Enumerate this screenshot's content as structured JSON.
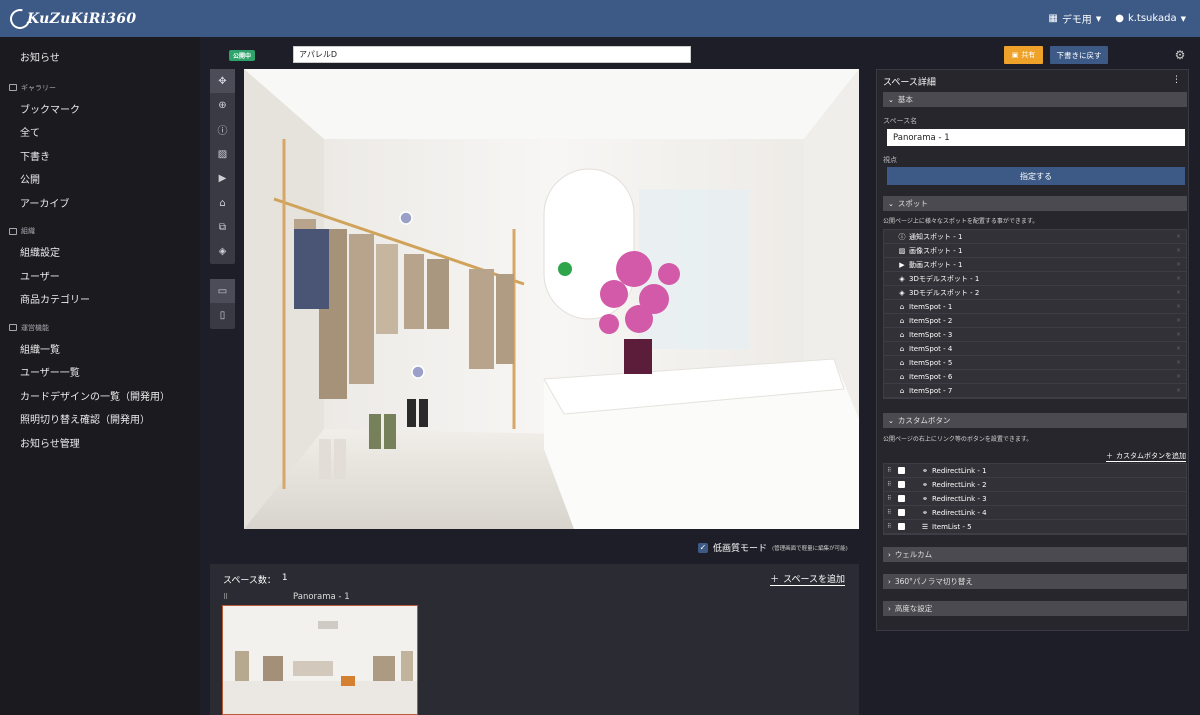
{
  "app": {
    "logo_text": "KuZuKiRi360"
  },
  "topbar": {
    "demo_label": "デモ用",
    "user_label": "k.tsukada"
  },
  "sidebar": {
    "top_item": "お知らせ",
    "sections": [
      {
        "title": "ギャラリー",
        "items": [
          "ブックマーク",
          "全て",
          "下書き",
          "公開",
          "アーカイブ"
        ]
      },
      {
        "title": "組織",
        "items": [
          "組織設定",
          "ユーザー",
          "商品カテゴリー"
        ]
      },
      {
        "title": "運営機能",
        "items": [
          "組織一覧",
          "ユーザー一覧",
          "カードデザインの一覧（開発用）",
          "照明切り替え確認（開発用）",
          "お知らせ管理"
        ]
      }
    ]
  },
  "editor": {
    "status": "公開中",
    "title_value": "アパレルD",
    "share_label": "共有",
    "draft_label": "下書きに戻す",
    "low_quality_label": "低画質モード",
    "low_quality_note": "(管理画面で軽量に編集が可能)"
  },
  "spaces": {
    "count_label": "スペース数：",
    "count": "1",
    "add_label": "スペースを追加",
    "items": [
      {
        "name": "Panorama - 1"
      }
    ]
  },
  "panel": {
    "title": "スペース詳細",
    "basic": {
      "header": "基本",
      "name_label": "スペース名",
      "name_value": "Panorama - 1",
      "viewpoint_label": "視点",
      "set_button": "指定する"
    },
    "spots": {
      "header": "スポット",
      "desc": "公開ページ上に様々なスポットを配置する事ができます。",
      "items": [
        {
          "icon": "info-icon",
          "label": "通知スポット - 1"
        },
        {
          "icon": "image-icon",
          "label": "画像スポット - 1"
        },
        {
          "icon": "video-icon",
          "label": "動画スポット - 1"
        },
        {
          "icon": "cube-icon",
          "label": "3Dモデルスポット - 1"
        },
        {
          "icon": "cube-icon",
          "label": "3Dモデルスポット - 2"
        },
        {
          "icon": "shirt-icon",
          "label": "ItemSpot - 1"
        },
        {
          "icon": "shirt-icon",
          "label": "ItemSpot - 2"
        },
        {
          "icon": "shirt-icon",
          "label": "ItemSpot - 3"
        },
        {
          "icon": "shirt-icon",
          "label": "ItemSpot - 4"
        },
        {
          "icon": "shirt-icon",
          "label": "ItemSpot - 5"
        },
        {
          "icon": "shirt-icon",
          "label": "ItemSpot - 6"
        },
        {
          "icon": "shirt-icon",
          "label": "ItemSpot - 7"
        }
      ]
    },
    "custom": {
      "header": "カスタムボタン",
      "desc": "公開ページの右上にリンク等のボタンを設置できます。",
      "add_label": "カスタムボタンを追加",
      "items": [
        {
          "icon": "link-icon",
          "label": "RedirectLink - 1"
        },
        {
          "icon": "link-icon",
          "label": "RedirectLink - 2"
        },
        {
          "icon": "link-icon",
          "label": "RedirectLink - 3"
        },
        {
          "icon": "link-icon",
          "label": "RedirectLink - 4"
        },
        {
          "icon": "list-icon",
          "label": "ItemList - 5"
        }
      ]
    },
    "collapsed": [
      "ウェルカム",
      "360°パノラマ切り替え",
      "高度な設定"
    ]
  }
}
